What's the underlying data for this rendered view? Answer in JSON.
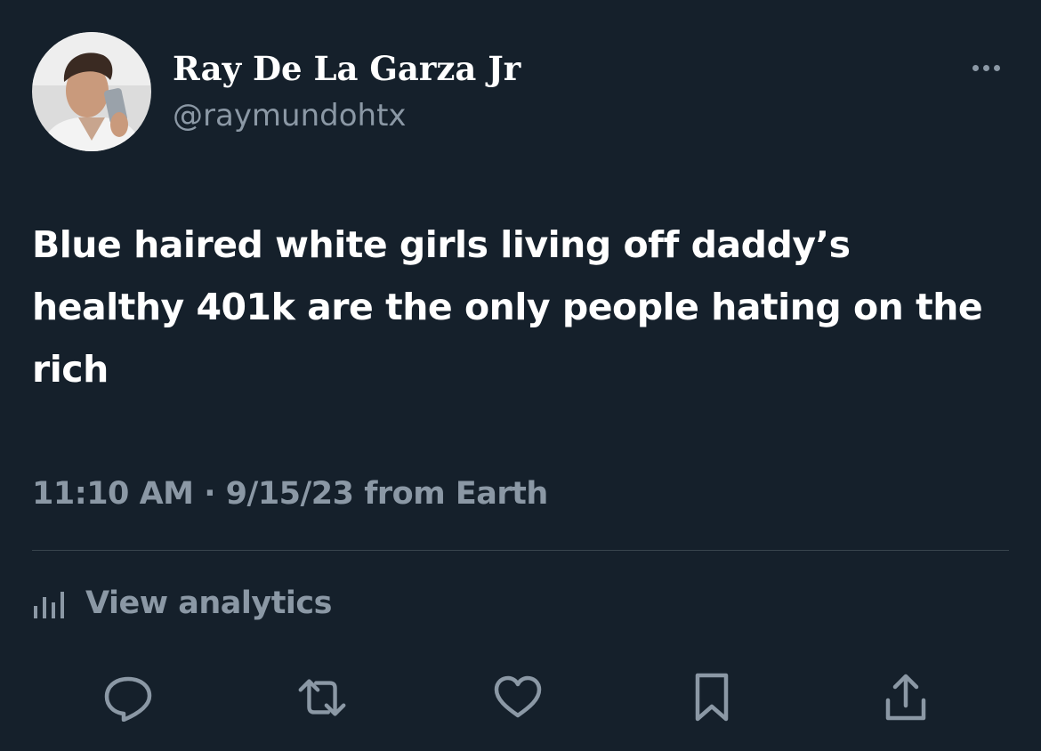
{
  "author": {
    "display_name": "Ray De La Garza Jr",
    "handle": "@raymundohtx"
  },
  "tweet": {
    "text": "Blue haired white girls living off daddy’s healthy 401k are the only people hating on the rich",
    "meta": "11:10 AM · 9/15/23 from Earth"
  },
  "analytics": {
    "label": "View analytics",
    "icon": "bar-chart-icon"
  },
  "actions": [
    {
      "icon": "reply-icon"
    },
    {
      "icon": "retweet-icon"
    },
    {
      "icon": "like-icon"
    },
    {
      "icon": "bookmark-icon"
    },
    {
      "icon": "share-icon"
    }
  ],
  "colors": {
    "background": "#15202b",
    "primary_text": "#ffffff",
    "secondary_text": "#8b98a5",
    "divider": "#38444d"
  }
}
